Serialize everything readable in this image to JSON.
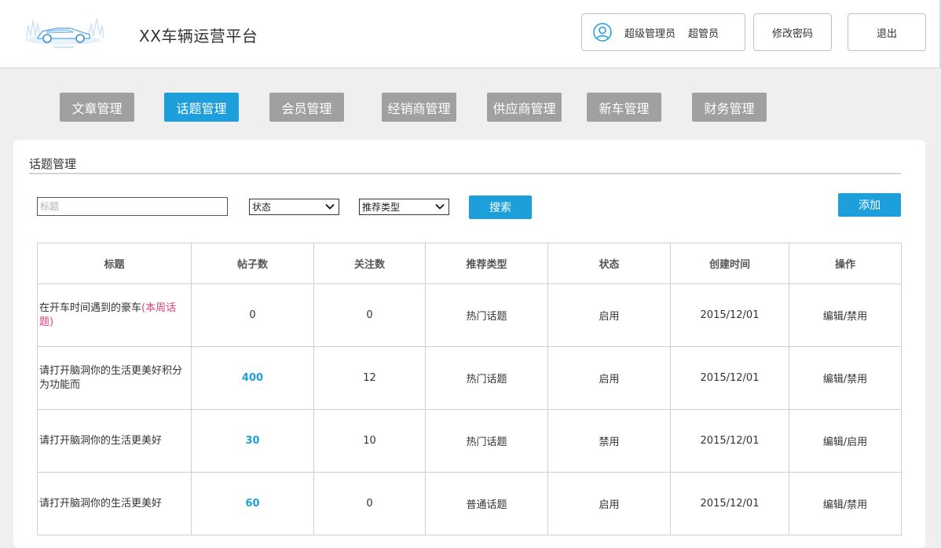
{
  "header": {
    "app_title": "XX车辆运营平台",
    "user_name": "超级管理员",
    "user_role": "超管员",
    "change_password_label": "修改密码",
    "logout_label": "退出"
  },
  "nav": {
    "tabs": [
      {
        "label": "文章管理",
        "active": false
      },
      {
        "label": "话题管理",
        "active": true
      },
      {
        "label": "会员管理",
        "active": false
      },
      {
        "label": "经销商管理",
        "active": false
      },
      {
        "label": "供应商管理",
        "active": false
      },
      {
        "label": "新车管理",
        "active": false
      },
      {
        "label": "财务管理",
        "active": false
      }
    ]
  },
  "panel": {
    "title": "话题管理",
    "search_placeholder": "标题",
    "status_select": "状态",
    "type_select": "推荐类型",
    "search_label": "搜索",
    "add_label": "添加"
  },
  "table": {
    "headers": [
      "标题",
      "帖子数",
      "关注数",
      "推荐类型",
      "状态",
      "创建时间",
      "操作"
    ],
    "rows": [
      {
        "title": "在开车时间遇到的豪车",
        "tag": "(本周话题)",
        "posts": "0",
        "posts_link": false,
        "follows": "0",
        "type": "热门话题",
        "status": "启用",
        "created": "2015/12/01",
        "actions": "编辑/禁用"
      },
      {
        "title": "请打开脑洞你的生活更美好积分为功能而",
        "tag": "",
        "posts": "400",
        "posts_link": true,
        "follows": "12",
        "type": "热门话题",
        "status": "启用",
        "created": "2015/12/01",
        "actions": "编辑/禁用"
      },
      {
        "title": "请打开脑洞你的生活更美好",
        "tag": "",
        "posts": "30",
        "posts_link": true,
        "follows": "10",
        "type": "热门话题",
        "status": "禁用",
        "created": "2015/12/01",
        "actions": "编辑/启用"
      },
      {
        "title": "请打开脑洞你的生活更美好",
        "tag": "",
        "posts": "60",
        "posts_link": true,
        "follows": "0",
        "type": "普通话题",
        "status": "启用",
        "created": "2015/12/01",
        "actions": "编辑/禁用"
      }
    ]
  },
  "colors": {
    "accent": "#1d9fdc",
    "tab_inactive": "#a0a0a0",
    "tag": "#e0407b"
  }
}
